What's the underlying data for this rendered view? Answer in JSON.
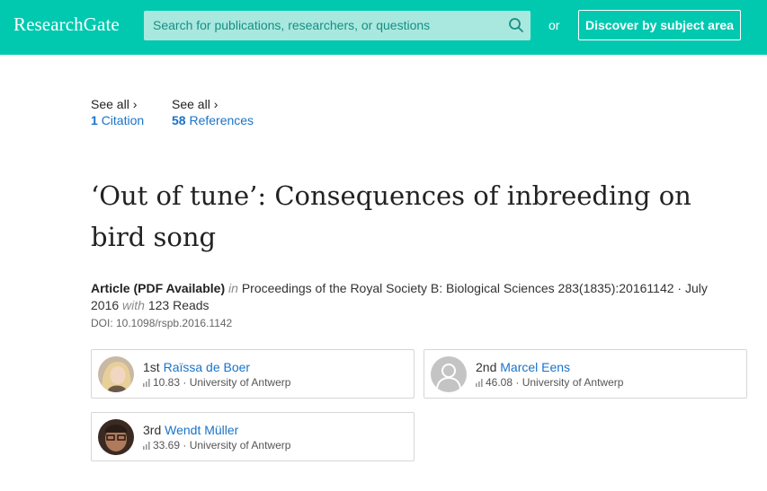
{
  "header": {
    "logo": "ResearchGate",
    "search_placeholder": "Search for publications, researchers, or questions",
    "or_label": "or",
    "discover_label": "Discover by subject area"
  },
  "stats": {
    "citations": {
      "see_all": "See all ›",
      "count": "1",
      "label": "Citation"
    },
    "references": {
      "see_all": "See all ›",
      "count": "58",
      "label": "References"
    }
  },
  "article": {
    "title": "‘Out of tune’: Consequences of inbreeding on bird song",
    "type": "Article (PDF Available)",
    "in_label": "in",
    "journal": "Proceedings of the Royal Society B: Biological Sciences 283(1835):20161142 · July 2016",
    "with_label": "with",
    "reads": "123 Reads",
    "doi": "DOI: 10.1098/rspb.2016.1142"
  },
  "authors": [
    {
      "rank": "1st",
      "name": "Raïssa de Boer",
      "score": "10.83",
      "affiliation": "· University of Antwerp",
      "avatar_icon": "author-photo-icon"
    },
    {
      "rank": "2nd",
      "name": "Marcel Eens",
      "score": "46.08",
      "affiliation": "· University of Antwerp",
      "avatar_icon": "default-user-icon"
    },
    {
      "rank": "3rd",
      "name": "Wendt Müller",
      "score": "33.69",
      "affiliation": "· University of Antwerp",
      "avatar_icon": "author-photo-icon"
    }
  ],
  "colors": {
    "brand": "#00c9b0",
    "link": "#1a73c8"
  }
}
